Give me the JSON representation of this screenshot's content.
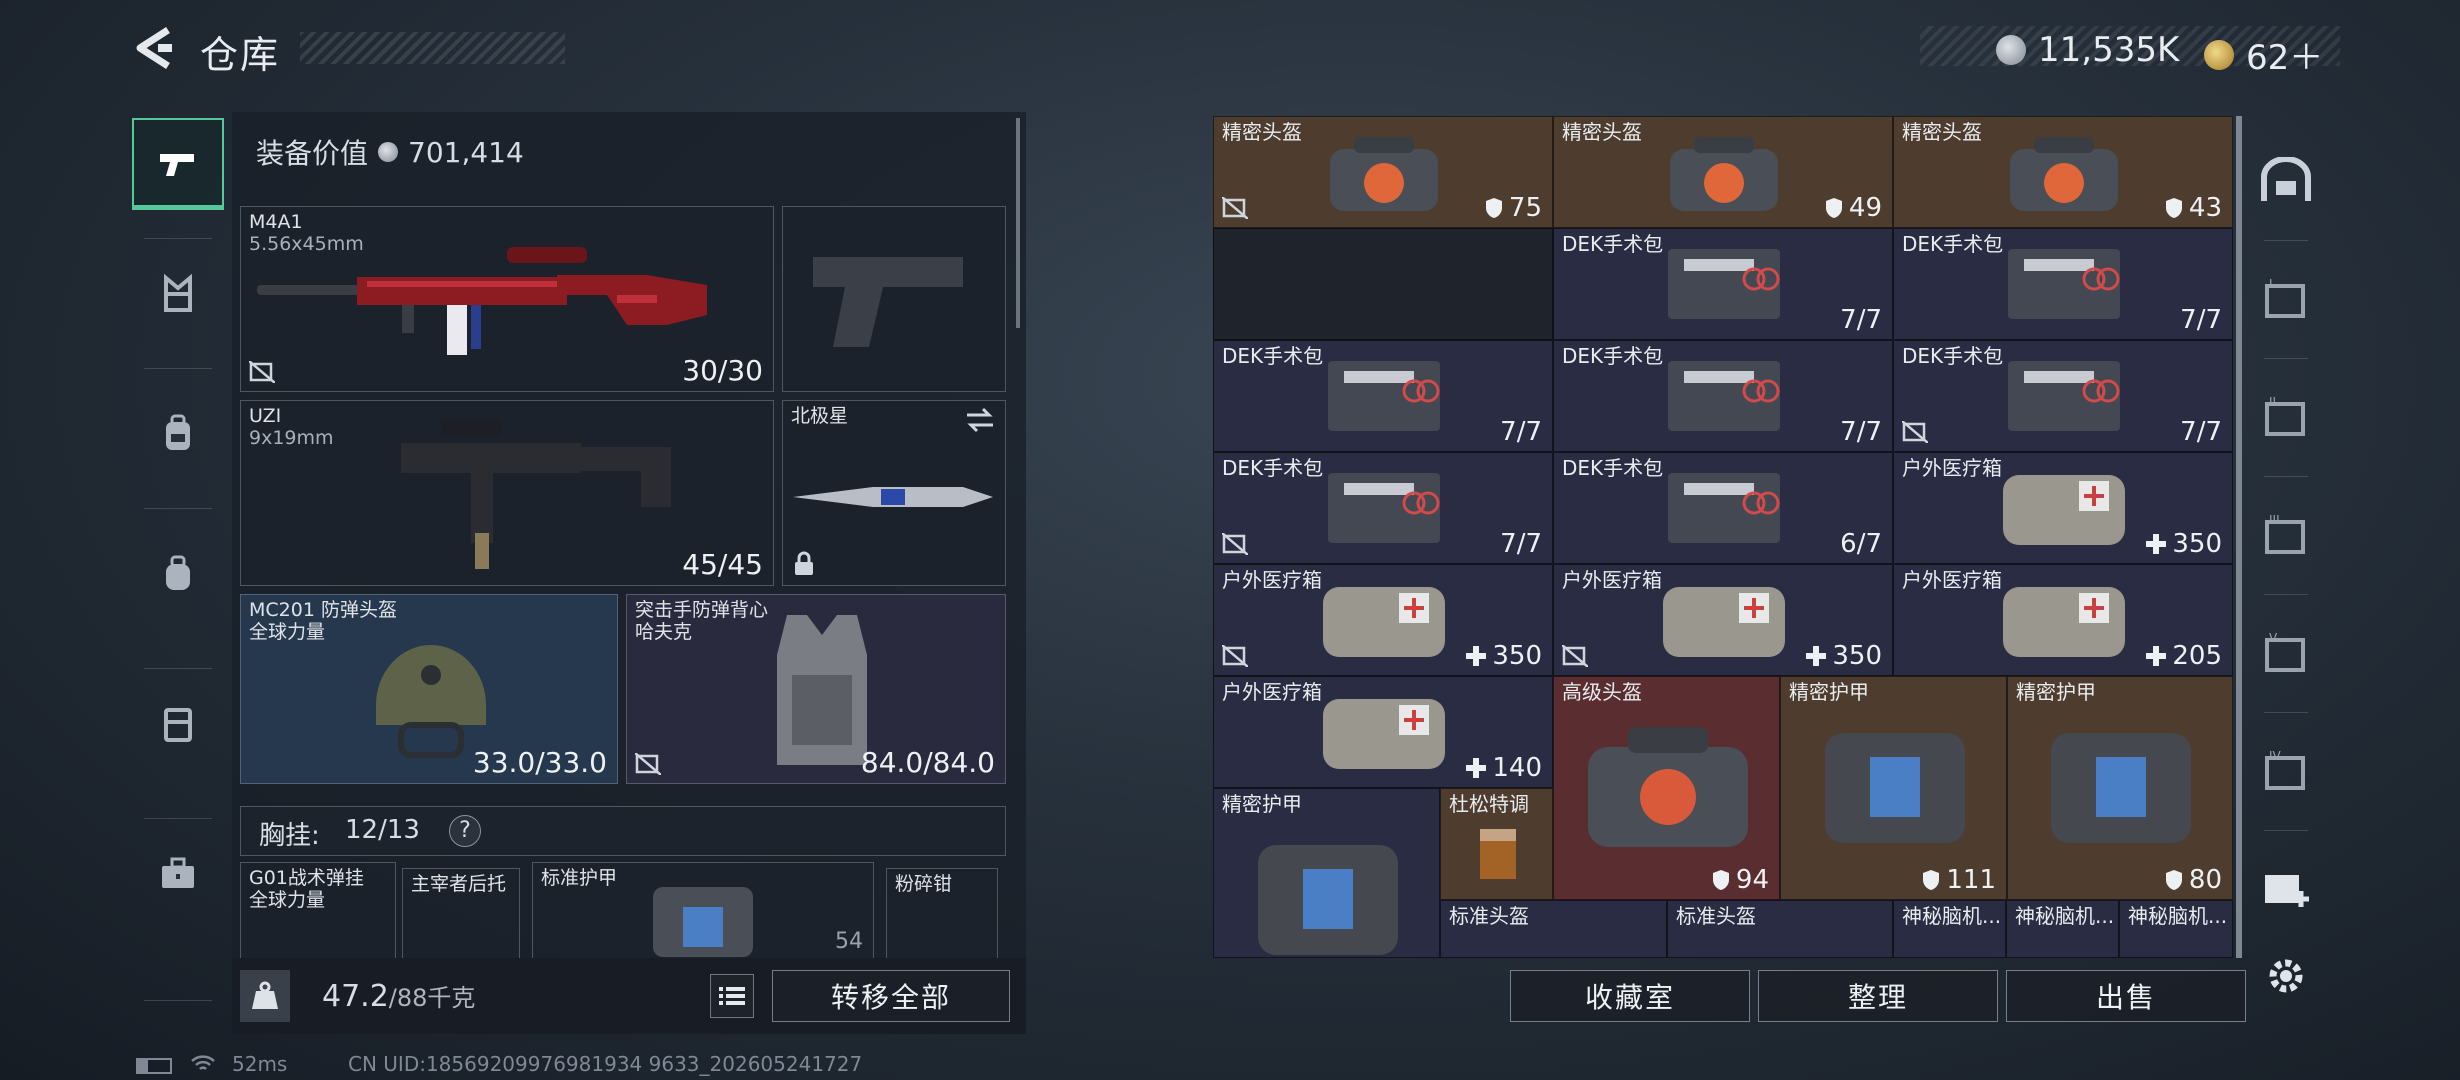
{
  "header": {
    "title": "仓库",
    "currency_silver": "11,535K",
    "currency_gold": "62＋"
  },
  "loadout": {
    "equip_value_label": "装备价值",
    "equip_value": "701,414",
    "primary": {
      "name": "M4A1",
      "caliber": "5.56x45mm",
      "ammo": "30/30"
    },
    "secondary": {
      "name": "UZI",
      "caliber": "9x19mm",
      "ammo": "45/45"
    },
    "melee": {
      "name": "北极星"
    },
    "helmet": {
      "name": "MC201 防弹头盔",
      "brand": "全球力量",
      "durability": "33.0/33.0"
    },
    "armor": {
      "name": "突击手防弹背心",
      "brand": "哈夫克",
      "durability": "84.0/84.0"
    },
    "chest_rig": {
      "label": "胸挂:",
      "count": "12/13",
      "help": "?"
    },
    "rig_items": [
      {
        "name": "G01战术弹挂",
        "brand": "全球力量"
      },
      {
        "name": "主宰者后托"
      },
      {
        "name": "标准护甲",
        "value": "54"
      },
      {
        "name": "粉碎钳"
      }
    ],
    "weight": "47.2",
    "weight_max": "/88千克",
    "transfer_all": "转移全部"
  },
  "inventory": {
    "items": [
      {
        "name": "精密头盔",
        "value": "75"
      },
      {
        "name": "精密头盔",
        "value": "49"
      },
      {
        "name": "精密头盔",
        "value": "43"
      },
      {
        "name": "DEK手术包",
        "value": "7/7"
      },
      {
        "name": "DEK手术包",
        "value": "7/7"
      },
      {
        "name": "DEK手术包",
        "value": "7/7"
      },
      {
        "name": "DEK手术包",
        "value": "7/7"
      },
      {
        "name": "DEK手术包",
        "value": "7/7"
      },
      {
        "name": "DEK手术包",
        "value": "7/7"
      },
      {
        "name": "DEK手术包",
        "value": "6/7"
      },
      {
        "name": "户外医疗箱",
        "value": "350"
      },
      {
        "name": "户外医疗箱",
        "value": "350"
      },
      {
        "name": "户外医疗箱",
        "value": "350"
      },
      {
        "name": "户外医疗箱",
        "value": "205"
      },
      {
        "name": "户外医疗箱",
        "value": "140"
      },
      {
        "name": "高级头盔",
        "value": "94"
      },
      {
        "name": "精密护甲",
        "value": "111"
      },
      {
        "name": "精密护甲",
        "value": "80"
      },
      {
        "name": "精密护甲"
      },
      {
        "name": "杜松特调"
      },
      {
        "name": "标准头盔"
      },
      {
        "name": "标准头盔"
      },
      {
        "name": "神秘脑机..."
      },
      {
        "name": "神秘脑机..."
      },
      {
        "name": "神秘脑机..."
      }
    ],
    "buttons": {
      "collection": "收藏室",
      "organize": "整理",
      "sell": "出售"
    }
  },
  "status": {
    "ping": "52ms",
    "uid": "CN UID:18569209976981934 9633_202605241727"
  }
}
